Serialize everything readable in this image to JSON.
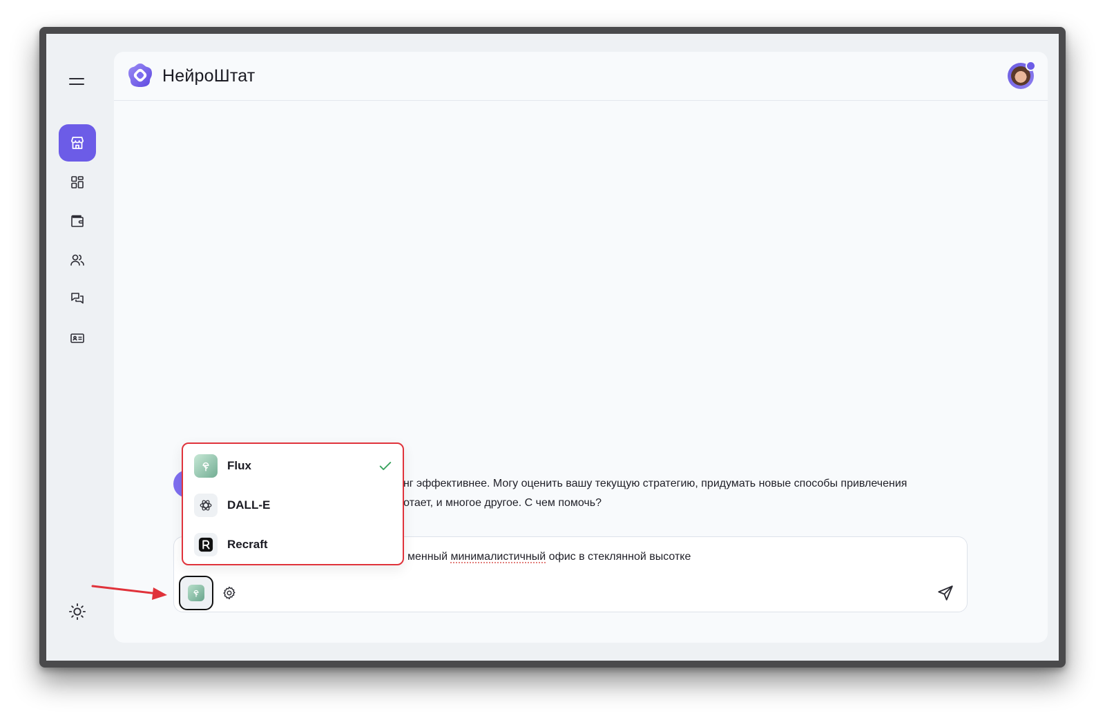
{
  "app": {
    "title": "НейроШтат",
    "brand_color": "#6c5ce7"
  },
  "sidebar": {
    "menu_icon": "hamburger-icon",
    "items": [
      {
        "name": "store",
        "icon": "store-icon",
        "active": true
      },
      {
        "name": "dashboard",
        "icon": "grid-icon",
        "active": false
      },
      {
        "name": "wallet",
        "icon": "wallet-icon",
        "active": false
      },
      {
        "name": "users",
        "icon": "users-icon",
        "active": false
      },
      {
        "name": "chats",
        "icon": "chat-icon",
        "active": false
      },
      {
        "name": "id-card",
        "icon": "id-card-icon",
        "active": false
      }
    ],
    "theme_icon": "sun-icon"
  },
  "chat": {
    "message_line1": "инг эффективнее. Могу оценить вашу текущую стратегию, придумать новые способы привлечения",
    "message_line2": "ботает, и многое другое. С чем помочь?"
  },
  "composer": {
    "text_before": "менный ",
    "text_misspelled": "минималистичный",
    "text_after": " офис в стеклянной высотке",
    "selected_model": "Flux"
  },
  "model_dropdown": {
    "items": [
      {
        "label": "Flux",
        "icon": "flux-icon",
        "selected": true
      },
      {
        "label": "DALL-E",
        "icon": "openai-icon",
        "selected": false
      },
      {
        "label": "Recraft",
        "icon": "recraft-icon",
        "selected": false
      }
    ],
    "highlight_color": "#e0323a"
  },
  "annotation": {
    "arrow_color": "#e0323a"
  }
}
